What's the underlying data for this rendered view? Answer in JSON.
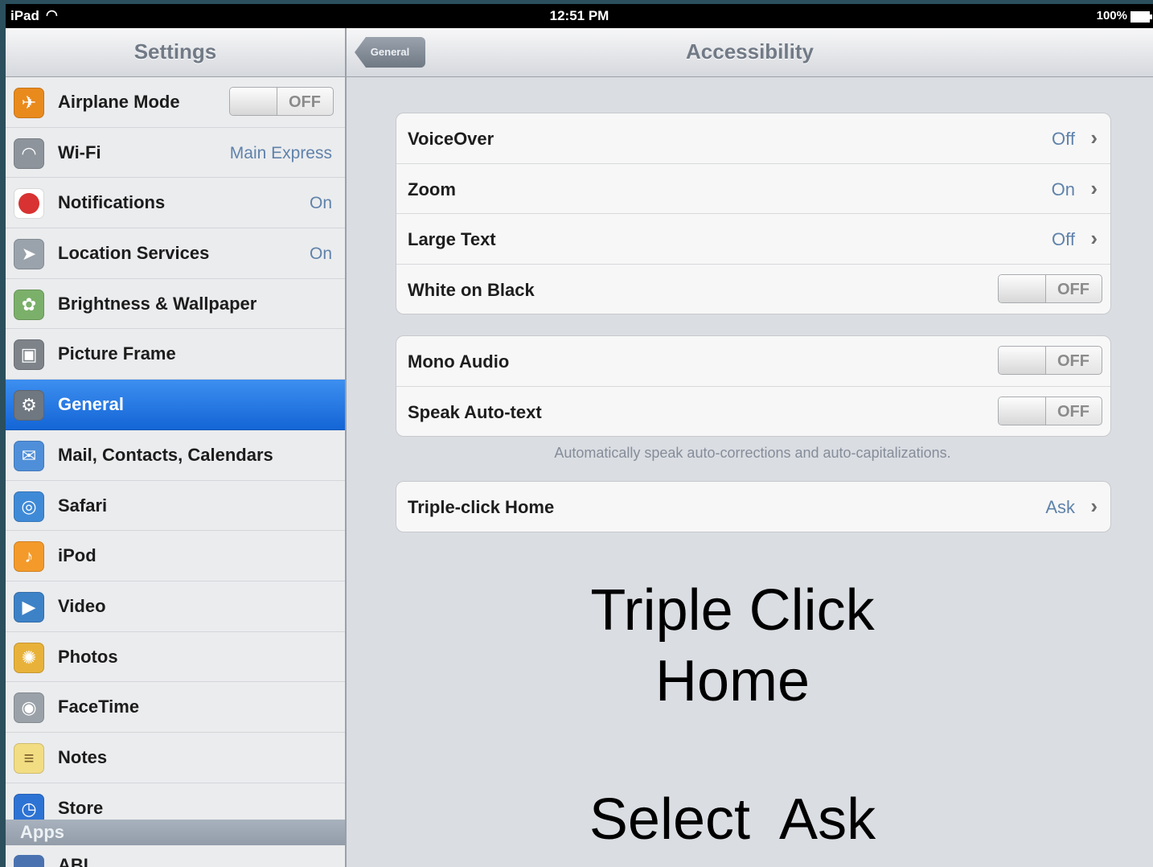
{
  "status": {
    "device": "iPad",
    "time": "12:51 PM",
    "battery": "100%"
  },
  "sidebar": {
    "title": "Settings",
    "items": [
      {
        "label": "Airplane Mode",
        "toggle": "OFF",
        "icon": "airplane-icon",
        "color": "#e98a1d"
      },
      {
        "label": "Wi-Fi",
        "value": "Main Express",
        "icon": "wifi-icon",
        "color": "#8d949c"
      },
      {
        "label": "Notifications",
        "value": "On",
        "icon": "notifications-icon",
        "color": "#d83232"
      },
      {
        "label": "Location Services",
        "value": "On",
        "icon": "location-icon",
        "color": "#9aa3ac"
      },
      {
        "label": "Brightness & Wallpaper",
        "icon": "brightness-icon",
        "color": "#7bb06a"
      },
      {
        "label": "Picture Frame",
        "icon": "picture-frame-icon",
        "color": "#7d8389"
      },
      {
        "label": "General",
        "icon": "gear-icon",
        "color": "#6f7780",
        "selected": true
      },
      {
        "label": "Mail, Contacts, Calendars",
        "icon": "mail-icon",
        "color": "#4f8fd9"
      },
      {
        "label": "Safari",
        "icon": "safari-icon",
        "color": "#3f8ad7"
      },
      {
        "label": "iPod",
        "icon": "ipod-icon",
        "color": "#f39a2a"
      },
      {
        "label": "Video",
        "icon": "video-icon",
        "color": "#3d82c7"
      },
      {
        "label": "Photos",
        "icon": "photos-icon",
        "color": "#e8b23a"
      },
      {
        "label": "FaceTime",
        "icon": "facetime-icon",
        "color": "#9aa1a8"
      },
      {
        "label": "Notes",
        "icon": "notes-icon",
        "color": "#f2dd83"
      },
      {
        "label": "Store",
        "icon": "store-icon",
        "color": "#2d73d4"
      }
    ],
    "apps_header": "Apps",
    "apps_partial": "ABI"
  },
  "main": {
    "back": "General",
    "title": "Accessibility",
    "group1": [
      {
        "label": "VoiceOver",
        "value": "Off"
      },
      {
        "label": "Zoom",
        "value": "On"
      },
      {
        "label": "Large Text",
        "value": "Off"
      },
      {
        "label": "White on Black",
        "toggle": "OFF"
      }
    ],
    "group2": [
      {
        "label": "Mono Audio",
        "toggle": "OFF"
      },
      {
        "label": "Speak Auto-text",
        "toggle": "OFF"
      }
    ],
    "note": "Automatically speak auto-corrections and auto-capitalizations.",
    "group3": [
      {
        "label": "Triple-click Home",
        "value": "Ask"
      }
    ]
  },
  "overlay": {
    "line1": "Triple Click",
    "line2": "Home",
    "line3": "Select  Ask"
  }
}
